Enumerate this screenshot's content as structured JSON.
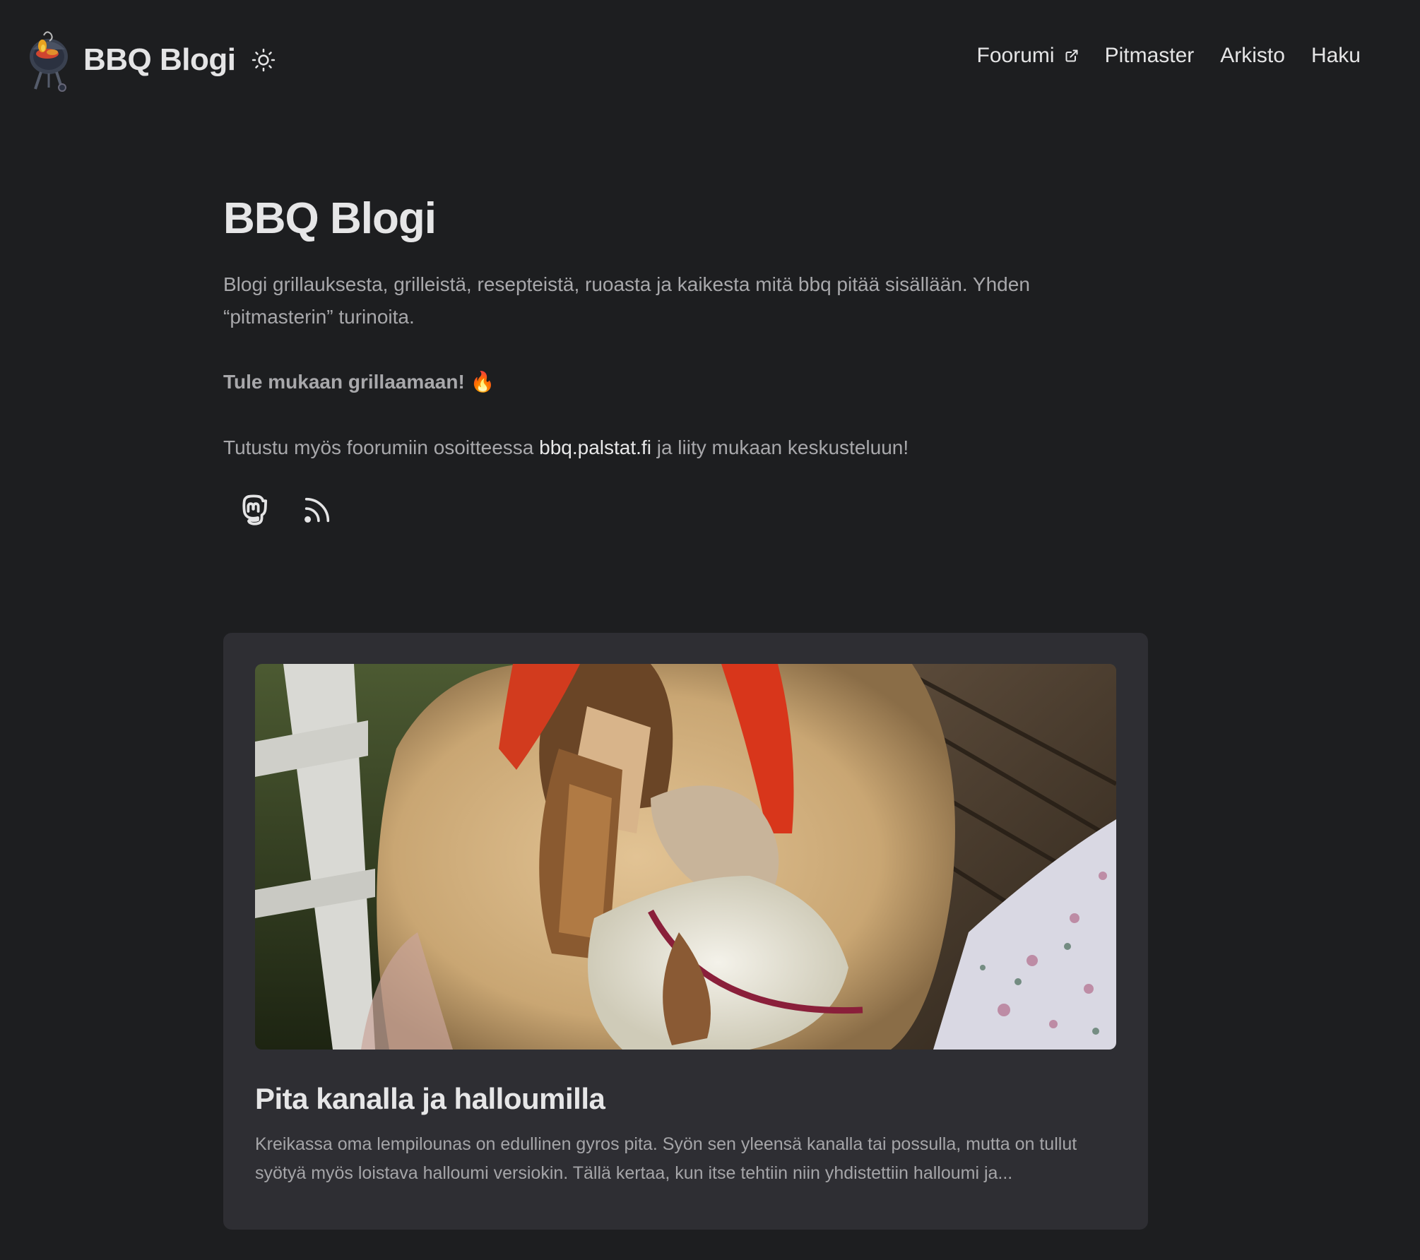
{
  "header": {
    "site_title": "BBQ Blogi",
    "logo_icon": "grill-logo-icon",
    "theme_toggle_icon": "sun-icon",
    "nav": [
      {
        "label": "Foorumi",
        "external": true
      },
      {
        "label": "Pitmaster"
      },
      {
        "label": "Arkisto"
      },
      {
        "label": "Haku"
      }
    ]
  },
  "hero": {
    "title": "BBQ Blogi",
    "description": "Blogi grillauksesta, grilleistä, resepteistä, ruoasta ja kaikesta mitä bbq pitää sisällään. Yhden “pitmasterin” turinoita.",
    "bold_line": "Tule mukaan grillaamaan! 🔥",
    "forum_prefix": "Tutustu myös foorumiin osoitteessa ",
    "forum_link": "bbq.palstat.fi",
    "forum_suffix": " ja liity mukaan keskusteluun!",
    "socials": [
      "mastodon-icon",
      "rss-icon"
    ]
  },
  "post": {
    "image_alt": "pita-photo",
    "title": "Pita kanalla ja halloumilla",
    "excerpt": "Kreikassa oma lempilounas on edullinen gyros pita. Syön sen yleensä kanalla tai possulla, mutta on tullut syötyä myös loistava halloumi versiokin. Tällä kertaa, kun itse tehtiin niin yhdistettiin halloumi ja..."
  },
  "colors": {
    "background": "#1d1e20",
    "card": "#2e2e33",
    "text_primary": "#e4e4e5",
    "text_secondary": "#a8a8ab"
  }
}
